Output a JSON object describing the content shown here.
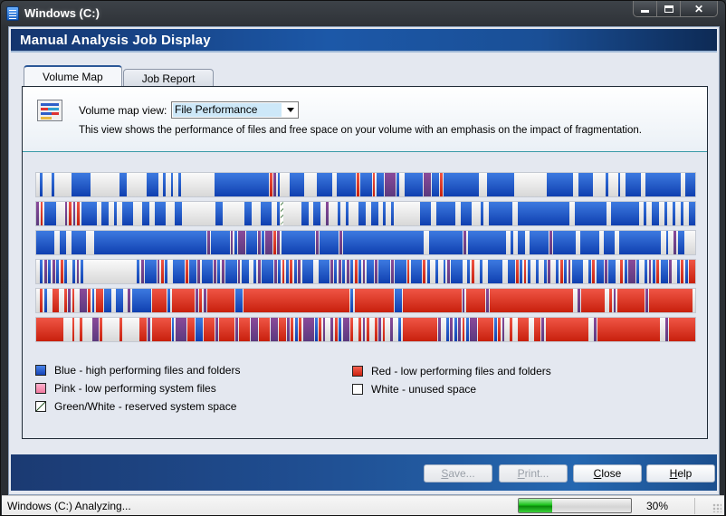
{
  "window": {
    "title": "Windows (C:)",
    "buttons": {
      "minimize": "minimize",
      "maximize": "maximize",
      "close": "✕"
    }
  },
  "header": {
    "title": "Manual Analysis Job Display"
  },
  "tabs": [
    {
      "label": "Volume Map",
      "active": true
    },
    {
      "label": "Job Report",
      "active": false
    }
  ],
  "view": {
    "label": "Volume map view:",
    "selected": "File Performance",
    "description": "This view shows the performance of files and free space on your volume with an emphasis on the impact of fragmentation."
  },
  "volume_map": {
    "legend_codes": {
      "b": "blue",
      "r": "red",
      "m": "mixed",
      "g": "green-white",
      "w": "white"
    },
    "rows": [
      "wbwwbwwwwbbbbbwwwwwwwbbwwwwwbbbwbwbwbwwwwwwwwbbbbbbbbbbbbbbrmbwwbbbbwwwbbbbwbbbbbrbbbrbbmmmbwbbbbbmmbbrbbbbbbbbbwwbbbbbbbwwwwwwwwbbbbbbbwbbbbwwwbwwbwbbbbwbbbbbbbbbwbbb",
      "mrbbbwwmrmrbbbbwbbwbwbbbwwbbwbbbwwbbwwwwwwwwbbwwwwwbbwwbbbwbgwwwwbbwbbwmwwbwbwwbbwbbwbwbwwwwwwbbbwbbbbbwbbbwwbwbbbbbbwbbbbbbbbbbbbbwbbbbbbbbwbbbbbbbwbwbbwbwbwbwbb",
      "bbbbbwbbwbbbbwwbbbbbbbbbbbbbbbbbbbbbbbbbbbbbmbbbbbmbmmbbbmbmmrmbbbbbbbbbmbbbbbmbbbbbbbbbbbbbbbbbbbbbwbbbbbbbbbmbbbbbbbbbbwbwbbwbbbbbmbbbbbbwbbbbbwbbbwbbbbbbbbbbbwbwmbbwww",
      "wbmbmbrbwbmbwwwwwwwwwwwwwbmbbbmrbwbbbrbbmbbbmbmbbbmbbwbmbbbmbrbrbmbbbwbbbmbmbmbrbmbbmbbbmbbbrbbbrbwbwbmbbbwbrwbwbbbbwbbrbrbwbwbmwbrbmbbbwbrbbmbbwrbmmbwbmbrbbmwbrbrr",
      "wrbwrrwrmrwmmrbrrbbwbbwmbbbbbrrrrbrrrrrrmrmrrrrrrrbbrrrrrrrrrrrrrrrrrrrrrrrrrrrbrrrrrrrrrrbbrrrrrrrrrrrrrrrmrrrrrmrrrrrrrrrrrrrrrrrrrrrwmrrrrrrwrmrrrrrrrmrrrrrrrrrrrw",
      "rrrrrrrwwrwrwwmmrwwwwrwwwwrrmrrrrrbmmmrrbbrrrmrrrrmrrrmmrrrmmrrmrbrmmmbrmwmrbmmrwrmrwrmrwmwbrrrrrrrrrmwbmbmrbmmrrrrbrmwrwrrrwrrmrrrrrrrrrrrwmrrrrrrrrrrrrrrrrwmrrrrrrr"
    ]
  },
  "legend": [
    {
      "swatch": "blue",
      "label": "Blue - high performing files and folders"
    },
    {
      "swatch": "pink",
      "label": "Pink - low performing system files"
    },
    {
      "swatch": "green-white",
      "label": "Green/White - reserved system space"
    },
    {
      "swatch": "red",
      "label": "Red - low performing files and folders"
    },
    {
      "swatch": "white",
      "label": "White - unused space"
    }
  ],
  "buttons": {
    "save": {
      "underline": "S",
      "rest": "ave...",
      "enabled": false
    },
    "print": {
      "underline": "P",
      "rest": "rint...",
      "enabled": false
    },
    "close": {
      "underline": "C",
      "rest": "lose",
      "enabled": true
    },
    "help": {
      "underline": "H",
      "rest": "elp",
      "enabled": true
    }
  },
  "status": {
    "text": "Windows (C:) Analyzing...",
    "progress": 0.3,
    "progress_label": "30%"
  },
  "colors": {
    "header_band": "#1c58a8",
    "map_blue": "#1f52c8",
    "map_red": "#e0301e",
    "progress_green": "#1cc21c"
  }
}
